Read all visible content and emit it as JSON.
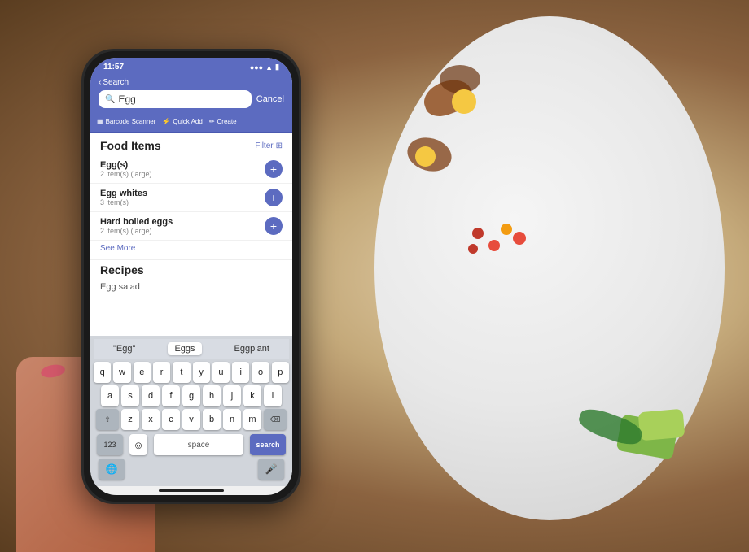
{
  "background": {
    "color": "#7a5c35"
  },
  "phone": {
    "status_bar": {
      "time": "11:57",
      "signal": "●●●",
      "wifi": "▲",
      "battery": "70"
    },
    "header": {
      "back_label": "Search",
      "search_placeholder": "Egg",
      "cancel_label": "Cancel"
    },
    "action_bar": {
      "items": [
        {
          "icon": "barcode",
          "label": "Barcode Scanner"
        },
        {
          "icon": "lightning",
          "label": "Quick Add"
        },
        {
          "icon": "pencil",
          "label": "Create"
        }
      ]
    },
    "food_section": {
      "title": "Food Items",
      "filter_label": "Filter",
      "items": [
        {
          "name": "Egg(s)",
          "detail": "2 item(s) (large)"
        },
        {
          "name": "Egg whites",
          "detail": "3 item(s)"
        },
        {
          "name": "Hard boiled eggs",
          "detail": "2 item(s) (large)"
        }
      ],
      "see_more_label": "See More"
    },
    "recipes_section": {
      "title": "Recipes",
      "items": [
        {
          "name": "Egg salad"
        }
      ]
    },
    "keyboard": {
      "predictive": [
        "\"Egg\"",
        "Eggs",
        "Eggplant"
      ],
      "rows": [
        [
          "q",
          "w",
          "e",
          "r",
          "t",
          "y",
          "u",
          "i",
          "o",
          "p"
        ],
        [
          "a",
          "s",
          "d",
          "f",
          "g",
          "h",
          "j",
          "k",
          "l"
        ],
        [
          "z",
          "x",
          "c",
          "v",
          "b",
          "n",
          "m"
        ]
      ],
      "space_label": "space",
      "search_label": "search",
      "num_label": "123",
      "shift_label": "⇧",
      "delete_label": "⌫",
      "emoji_label": "☺",
      "globe_label": "🌐",
      "mic_label": "🎤"
    }
  }
}
